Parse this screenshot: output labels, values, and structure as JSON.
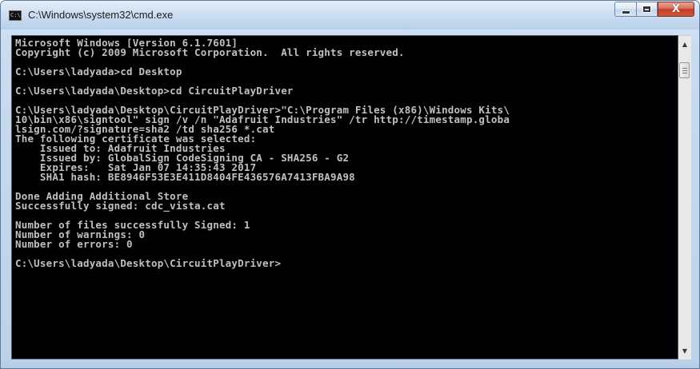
{
  "window": {
    "title": "C:\\Windows\\system32\\cmd.exe",
    "icon": "cmd-icon",
    "icon_text": "C:\\"
  },
  "caption_buttons": {
    "minimize": "minimize-icon",
    "maximize": "maximize-icon",
    "close": "close-icon",
    "close_glyph": "X"
  },
  "console": {
    "lines": [
      "Microsoft Windows [Version 6.1.7601]",
      "Copyright (c) 2009 Microsoft Corporation.  All rights reserved.",
      "",
      "C:\\Users\\ladyada>cd Desktop",
      "",
      "C:\\Users\\ladyada\\Desktop>cd CircuitPlayDriver",
      "",
      "C:\\Users\\ladyada\\Desktop\\CircuitPlayDriver>\"C:\\Program Files (x86)\\Windows Kits\\",
      "10\\bin\\x86\\signtool\" sign /v /n \"Adafruit Industries\" /tr http://timestamp.globa",
      "lsign.com/?signature=sha2 /td sha256 *.cat",
      "The following certificate was selected:",
      "    Issued to: Adafruit Industries",
      "    Issued by: GlobalSign CodeSigning CA - SHA256 - G2",
      "    Expires:   Sat Jan 07 14:35:43 2017",
      "    SHA1 hash: BE8946F53E3E411D8404FE436576A7413FBA9A98",
      "",
      "Done Adding Additional Store",
      "Successfully signed: cdc_vista.cat",
      "",
      "Number of files successfully Signed: 1",
      "Number of warnings: 0",
      "Number of errors: 0",
      "",
      "C:\\Users\\ladyada\\Desktop\\CircuitPlayDriver>"
    ]
  },
  "scrollbar": {
    "up_arrow": "▲",
    "down_arrow": "▼"
  }
}
